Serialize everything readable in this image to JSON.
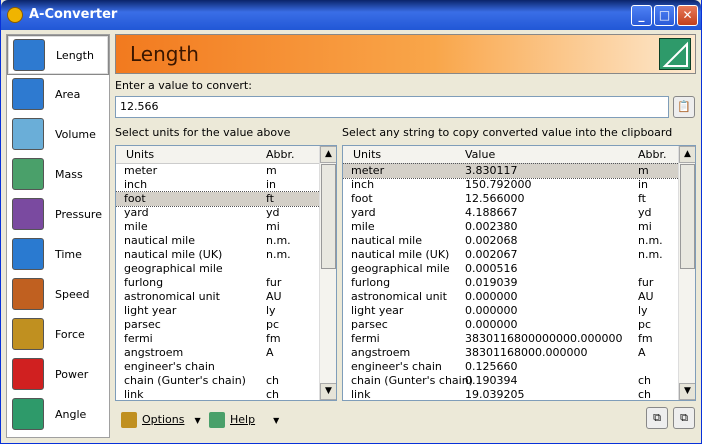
{
  "window": {
    "title": "A-Converter",
    "min": "_",
    "max": "□",
    "close": "✕"
  },
  "sidebar": [
    {
      "label": "Length",
      "icon": "ruler-triangle-icon",
      "color": "#2e7ad0"
    },
    {
      "label": "Area",
      "icon": "area-grid-icon",
      "color": "#2e7ad0"
    },
    {
      "label": "Volume",
      "icon": "beaker-icon",
      "color": "#6aaed8"
    },
    {
      "label": "Mass",
      "icon": "weight-icon",
      "color": "#4aa06a"
    },
    {
      "label": "Pressure",
      "icon": "pressure-clamp-icon",
      "color": "#7a4aa0"
    },
    {
      "label": "Time",
      "icon": "clock-icon",
      "color": "#2a7ad0"
    },
    {
      "label": "Speed",
      "icon": "car-icon",
      "color": "#c06020"
    },
    {
      "label": "Force",
      "icon": "gears-icon",
      "color": "#c09020"
    },
    {
      "label": "Power",
      "icon": "battery-icon",
      "color": "#d02020"
    },
    {
      "label": "Angle",
      "icon": "protractor-icon",
      "color": "#2e9a6a"
    }
  ],
  "header": {
    "title": "Length"
  },
  "input": {
    "label": "Enter a value to convert:",
    "value": "12.566"
  },
  "left": {
    "label": "Select units for the value above",
    "col_units": "Units",
    "col_abbr": "Abbr.",
    "rows": [
      [
        "meter",
        "m"
      ],
      [
        "inch",
        "in"
      ],
      [
        "foot",
        "ft"
      ],
      [
        "yard",
        "yd"
      ],
      [
        "mile",
        "mi"
      ],
      [
        "nautical mile",
        "n.m."
      ],
      [
        "nautical mile (UK)",
        "n.m."
      ],
      [
        "geographical mile",
        ""
      ],
      [
        "furlong",
        "fur"
      ],
      [
        "astronomical unit",
        "AU"
      ],
      [
        "light year",
        "ly"
      ],
      [
        "parsec",
        "pc"
      ],
      [
        "fermi",
        "fm"
      ],
      [
        "angstroem",
        "A"
      ],
      [
        "engineer's chain",
        ""
      ],
      [
        "chain (Gunter's chain)",
        "ch"
      ],
      [
        "link",
        "ch"
      ]
    ],
    "selected": 2
  },
  "right": {
    "label": "Select any string to copy converted value into the clipboard",
    "col_units": "Units",
    "col_value": "Value",
    "col_abbr": "Abbr.",
    "rows": [
      [
        "meter",
        "3.830117",
        "m"
      ],
      [
        "inch",
        "150.792000",
        "in"
      ],
      [
        "foot",
        "12.566000",
        "ft"
      ],
      [
        "yard",
        "4.188667",
        "yd"
      ],
      [
        "mile",
        "0.002380",
        "mi"
      ],
      [
        "nautical mile",
        "0.002068",
        "n.m."
      ],
      [
        "nautical mile (UK)",
        "0.002067",
        "n.m."
      ],
      [
        "geographical mile",
        "0.000516",
        ""
      ],
      [
        "furlong",
        "0.019039",
        "fur"
      ],
      [
        "astronomical unit",
        "0.000000",
        "AU"
      ],
      [
        "light year",
        "0.000000",
        "ly"
      ],
      [
        "parsec",
        "0.000000",
        "pc"
      ],
      [
        "fermi",
        "3830116800000000.000000",
        "fm"
      ],
      [
        "angstroem",
        "38301168000.000000",
        "A"
      ],
      [
        "engineer's chain",
        "0.125660",
        ""
      ],
      [
        "chain (Gunter's chain)",
        "0.190394",
        "ch"
      ],
      [
        "link",
        "19.039205",
        "ch"
      ]
    ],
    "selected": 0
  },
  "bottom": {
    "options": "Options",
    "help": "Help"
  }
}
